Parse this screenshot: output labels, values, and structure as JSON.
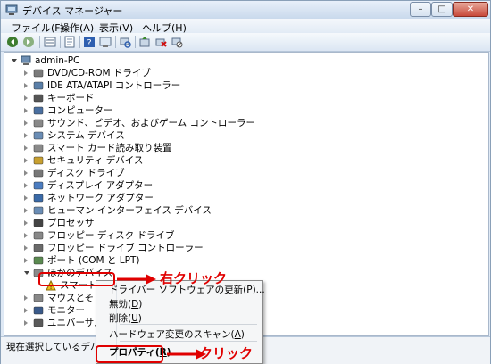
{
  "window": {
    "title": "デバイス マネージャー",
    "controls": {
      "minimize": "–",
      "maximize": "□",
      "close": "✕"
    }
  },
  "menu": [
    {
      "label": "ファイル(F)"
    },
    {
      "label": "操作(A)"
    },
    {
      "label": "表示(V)"
    },
    {
      "label": "ヘルプ(H)"
    }
  ],
  "toolbar": {
    "icons": [
      "back-icon",
      "forward-icon",
      "view-icon",
      "properties-icon",
      "help-icon",
      "scan-icon",
      "update-driver-icon",
      "disable-icon",
      "uninstall-icon"
    ]
  },
  "tree": {
    "root": "admin-PC",
    "items": [
      {
        "label": "DVD/CD-ROM ドライブ",
        "icon": "dvd-drive-icon"
      },
      {
        "label": "IDE ATA/ATAPI コントローラー",
        "icon": "ide-controller-icon"
      },
      {
        "label": "キーボード",
        "icon": "keyboard-icon"
      },
      {
        "label": "コンピューター",
        "icon": "computer-icon"
      },
      {
        "label": "サウンド、ビデオ、およびゲーム コントローラー",
        "icon": "sound-icon"
      },
      {
        "label": "システム デバイス",
        "icon": "system-device-icon"
      },
      {
        "label": "スマート カード読み取り装置",
        "icon": "smartcard-reader-icon"
      },
      {
        "label": "セキュリティ デバイス",
        "icon": "security-device-icon"
      },
      {
        "label": "ディスク ドライブ",
        "icon": "disk-drive-icon"
      },
      {
        "label": "ディスプレイ アダプター",
        "icon": "display-adapter-icon"
      },
      {
        "label": "ネットワーク アダプター",
        "icon": "network-adapter-icon"
      },
      {
        "label": "ヒューマン インターフェイス デバイス",
        "icon": "hid-icon"
      },
      {
        "label": "プロセッサ",
        "icon": "processor-icon"
      },
      {
        "label": "フロッピー ディスク ドライブ",
        "icon": "floppy-drive-icon"
      },
      {
        "label": "フロッピー ドライブ コントローラー",
        "icon": "floppy-controller-icon"
      },
      {
        "label": "ポート (COM と LPT)",
        "icon": "port-icon"
      },
      {
        "label": "ほかのデバイス",
        "icon": "other-devices-icon"
      },
      {
        "label": "スマート カード",
        "icon": "warning-device-icon"
      },
      {
        "label": "マウスとそ",
        "icon": "mouse-icon"
      },
      {
        "label": "モニター",
        "icon": "monitor-icon"
      },
      {
        "label": "ユニバーサル",
        "icon": "usb-icon"
      }
    ]
  },
  "context_menu": {
    "items": [
      {
        "label": "ドライバー ソフトウェアの更新(",
        "key": "P",
        "suffix": ")..."
      },
      {
        "label": "無効(",
        "key": "D",
        "suffix": ")"
      },
      {
        "label": "削除(",
        "key": "U",
        "suffix": ")"
      },
      {
        "label": "ハードウェア変更のスキャン(",
        "key": "A",
        "suffix": ")"
      },
      {
        "label": "プロパティ(",
        "key": "R",
        "suffix": ")"
      }
    ]
  },
  "annotations": {
    "right_click": "右クリック",
    "click": "クリック"
  },
  "status": {
    "text": "現在選択しているデバ"
  },
  "colors": {
    "accent_red": "#e00000",
    "window_frame": "#dfe9f5"
  }
}
